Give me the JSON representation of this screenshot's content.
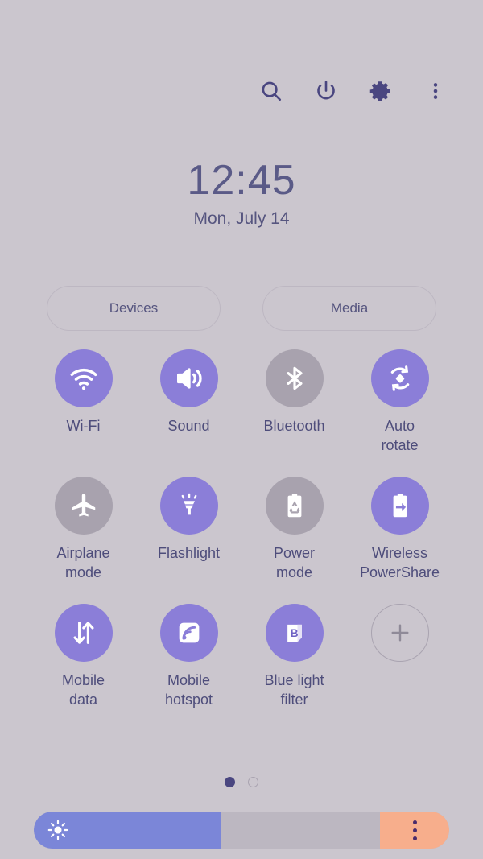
{
  "header": {
    "actions": [
      {
        "name": "search-icon",
        "label": "Search"
      },
      {
        "name": "power-icon",
        "label": "Power off"
      },
      {
        "name": "settings-icon",
        "label": "Settings"
      },
      {
        "name": "more-icon",
        "label": "More options"
      }
    ]
  },
  "clock": {
    "time": "12:45",
    "date": "Mon, July 14"
  },
  "pills": [
    {
      "label": "Devices"
    },
    {
      "label": "Media"
    }
  ],
  "toggles": [
    {
      "label": "Wi-Fi",
      "icon": "wifi-icon",
      "state": "on"
    },
    {
      "label": "Sound",
      "icon": "sound-icon",
      "state": "on"
    },
    {
      "label": "Bluetooth",
      "icon": "bluetooth-icon",
      "state": "off"
    },
    {
      "label": "Auto\nrotate",
      "icon": "auto-rotate-icon",
      "state": "on"
    },
    {
      "label": "Airplane\nmode",
      "icon": "airplane-icon",
      "state": "off"
    },
    {
      "label": "Flashlight",
      "icon": "flashlight-icon",
      "state": "on"
    },
    {
      "label": "Power\nmode",
      "icon": "power-mode-icon",
      "state": "off"
    },
    {
      "label": "Wireless\nPowerShare",
      "icon": "wireless-powershare-icon",
      "state": "on"
    },
    {
      "label": "Mobile\ndata",
      "icon": "mobile-data-icon",
      "state": "on"
    },
    {
      "label": "Mobile\nhotspot",
      "icon": "mobile-hotspot-icon",
      "state": "on"
    },
    {
      "label": "Blue light\nfilter",
      "icon": "blue-light-filter-icon",
      "state": "on"
    },
    {
      "label": "",
      "icon": "plus-icon",
      "state": "add"
    }
  ],
  "pagination": {
    "pages": 2,
    "current": 1
  },
  "brightness": {
    "level_percent": 45,
    "icon": "brightness-sun-icon",
    "menu_icon": "more-vertical-icon"
  },
  "colors": {
    "background": "#cbc6ce",
    "accent_on": "#8b7ed8",
    "accent_off": "#a8a2ae",
    "text": "#4e4d7b",
    "slider_fill": "#7b86d8",
    "slider_track": "#bcb7c1",
    "slider_menu": "#f7ae8c"
  }
}
